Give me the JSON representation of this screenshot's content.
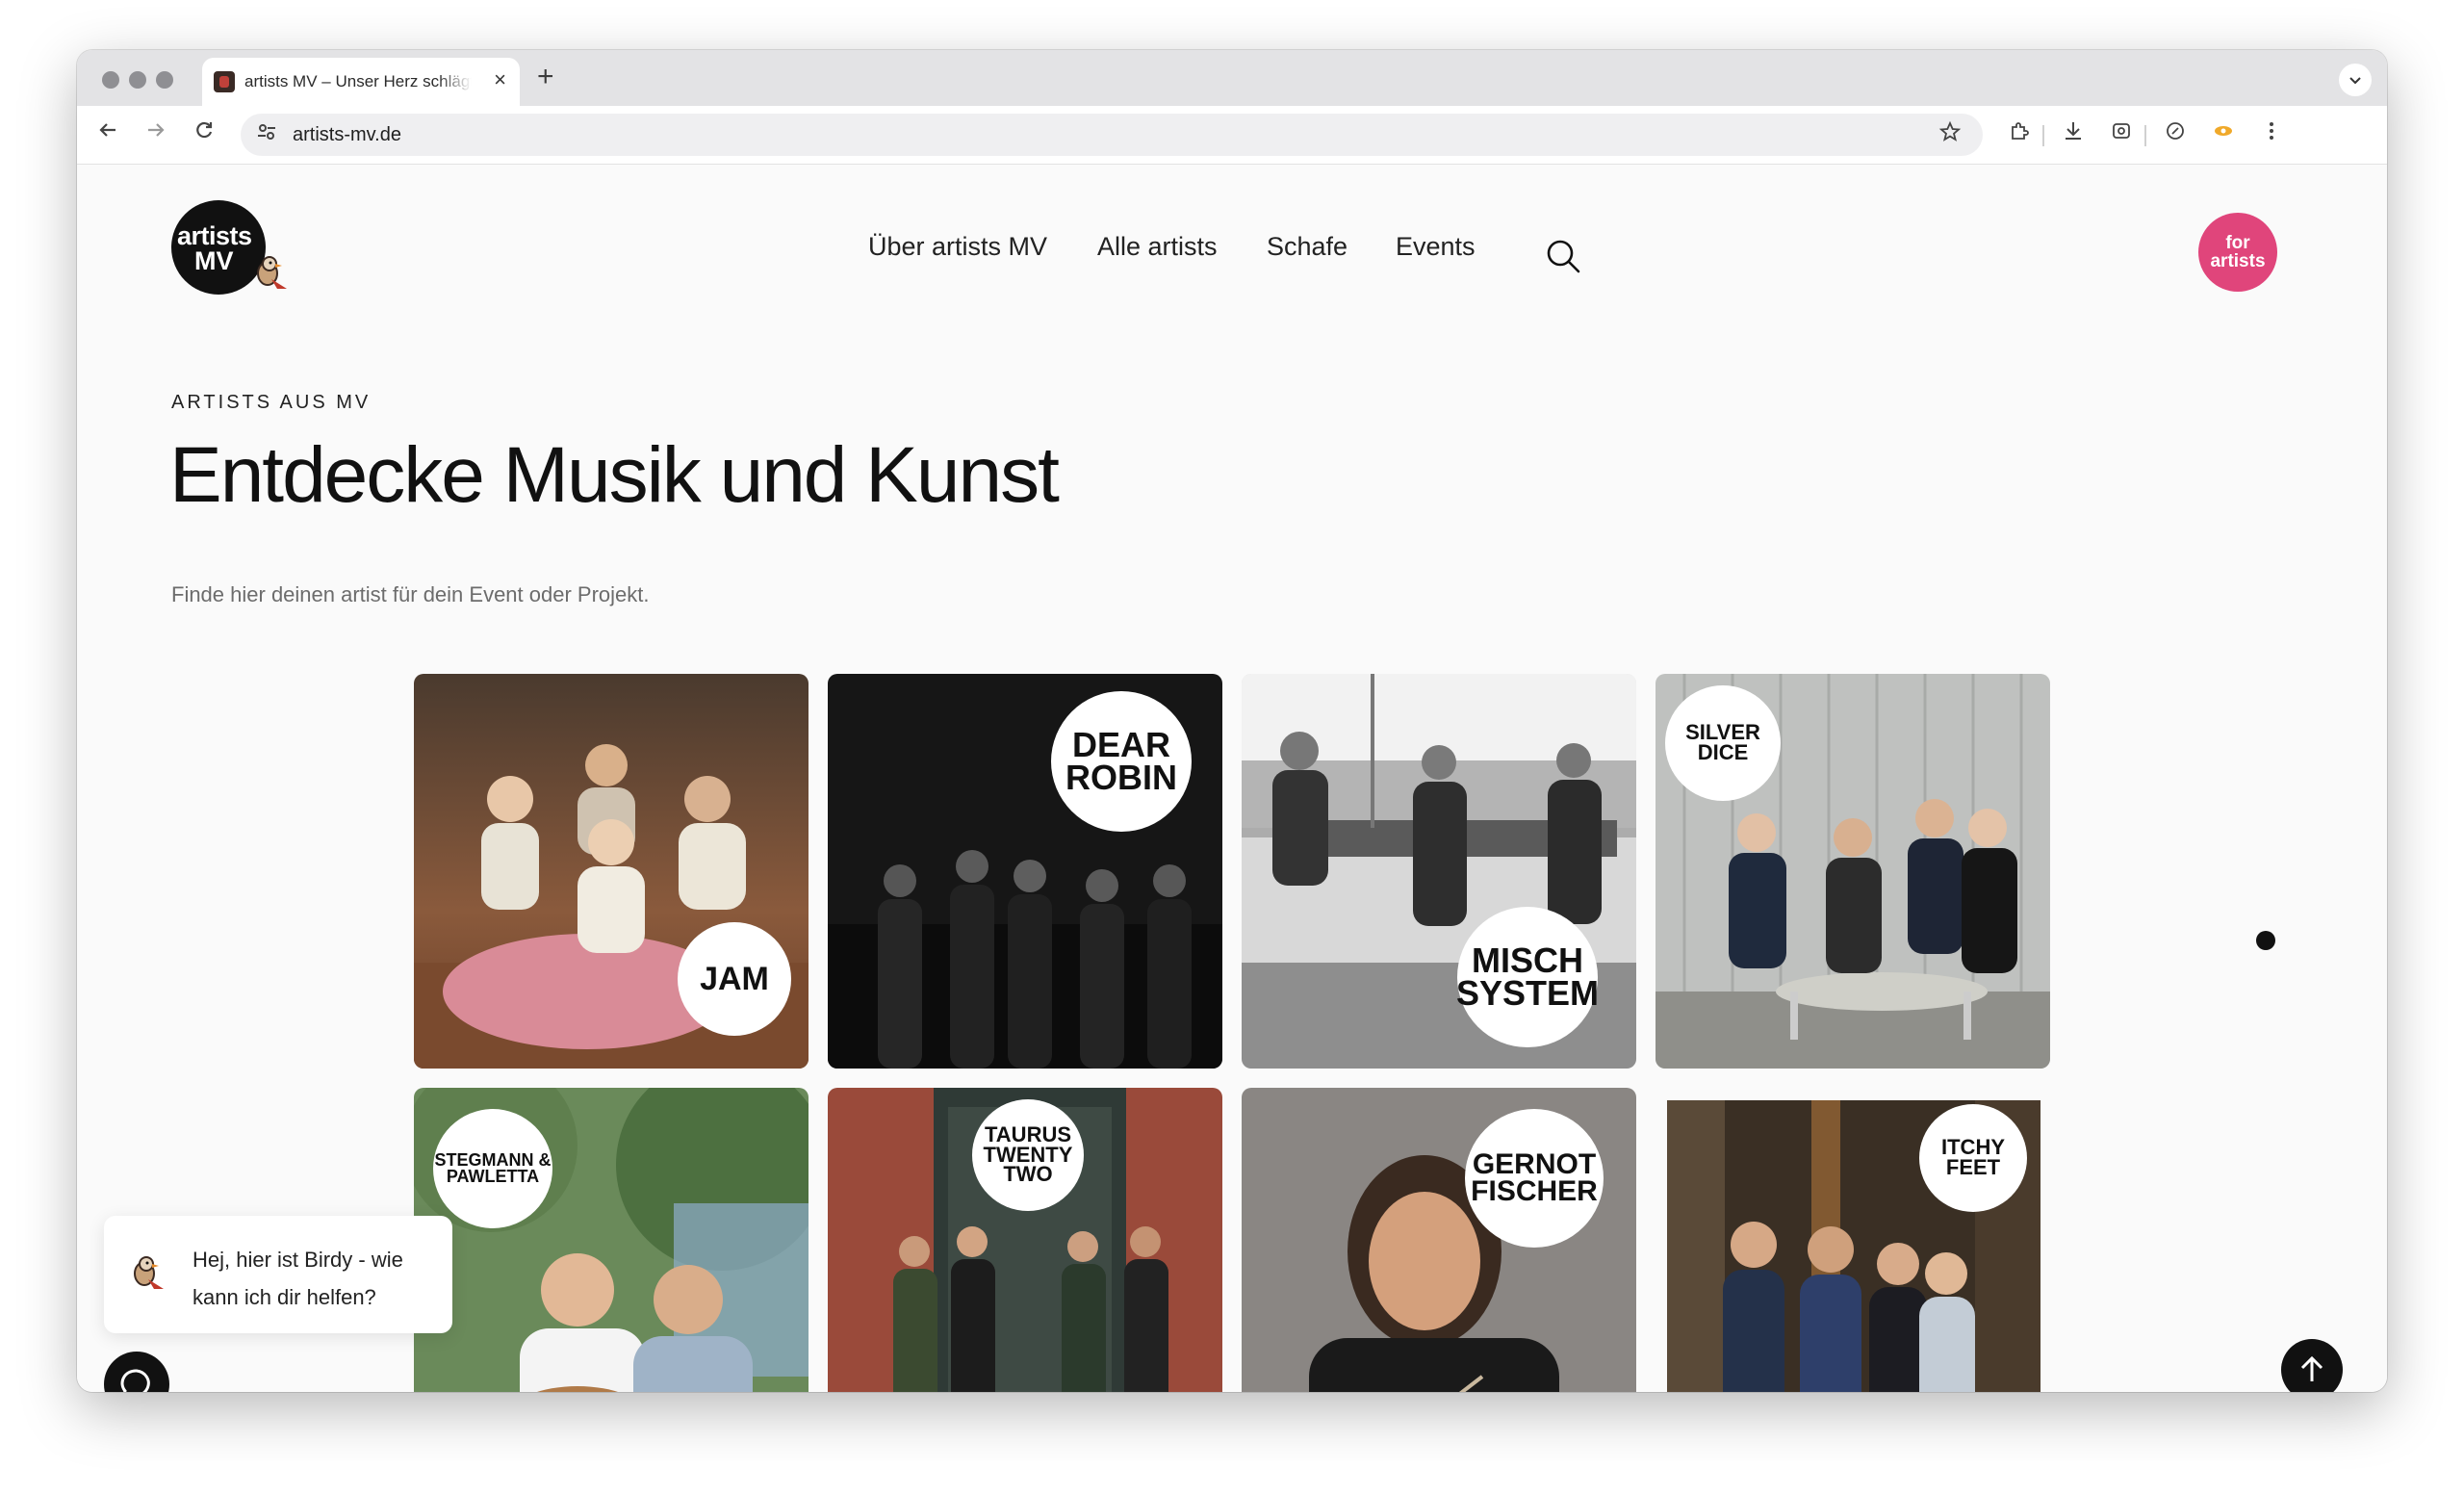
{
  "browser": {
    "tab_title": "artists MV – Unser Herz schlägt",
    "new_tab": "+",
    "close": "×",
    "url": "artists-mv.de"
  },
  "site": {
    "logo_line1": "artists",
    "logo_line2": "MV",
    "nav": [
      "Über artists MV",
      "Alle artists",
      "Schafe",
      "Events"
    ],
    "for_artists_line1": "for",
    "for_artists_line2": "artists"
  },
  "hero": {
    "eyebrow": "ARTISTS AUS MV",
    "headline": "Entdecke Musik und Kunst",
    "subline": "Finde hier deinen artist für dein Event oder Projekt."
  },
  "artists": [
    {
      "name": "JAM"
    },
    {
      "name": "DEAR ROBIN"
    },
    {
      "name": "MISCH SYSTEM"
    },
    {
      "name": "SILVER DICE"
    },
    {
      "name": "STEGMANN & PAWLETTA"
    },
    {
      "name": "TAURUS TWENTY TWO"
    },
    {
      "name": "GERNOT FISCHER"
    },
    {
      "name": "ITCHY FEET"
    }
  ],
  "chat": {
    "message": "Hej, hier ist Birdy - wie kann ich dir helfen?"
  }
}
